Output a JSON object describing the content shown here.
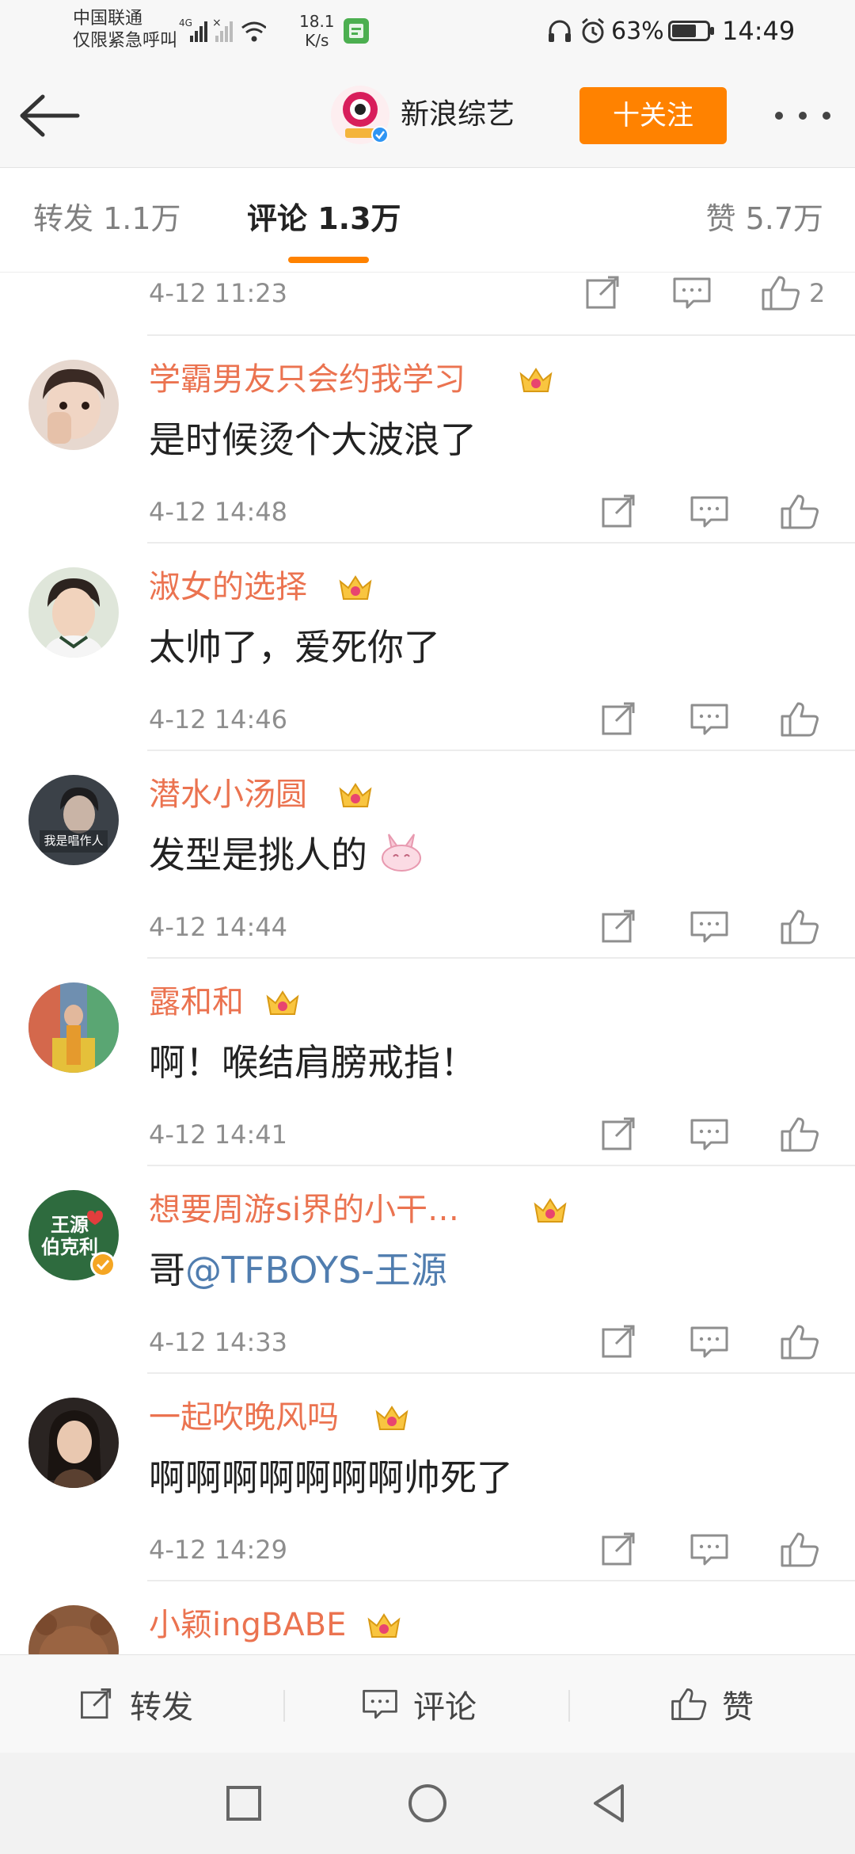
{
  "status_bar": {
    "carrier_line1": "中国联通",
    "carrier_line2": "仅限紧急呼叫",
    "network_type": "4G",
    "speed_value": "18.1",
    "speed_unit": "K/s",
    "battery": "63%",
    "time": "14:49"
  },
  "header": {
    "account_name": "新浪综艺",
    "follow_label": "十关注"
  },
  "tabs": [
    {
      "label": "转发 1.1万"
    },
    {
      "label": "评论 1.3万"
    },
    {
      "label": "赞 5.7万"
    }
  ],
  "partial_comment": {
    "time": "4-12 11:23",
    "like_count": "2"
  },
  "comments": [
    {
      "username": "学霸男友只会约我学习",
      "text": "是时候烫个大波浪了",
      "time": "4-12 14:48"
    },
    {
      "username": "淑女的选择",
      "text": "太帅了，爱死你了",
      "time": "4-12 14:46"
    },
    {
      "username": "潜水小汤圆",
      "text": "发型是挑人的",
      "time": "4-12 14:44",
      "avatar_text": "我是唱作人"
    },
    {
      "username": "露和和",
      "text": "啊！喉结肩膀戒指！",
      "time": "4-12 14:41"
    },
    {
      "username": "想要周游si界的小干…",
      "text_prefix": "哥",
      "mention": "@TFBOYS-王源",
      "time": "4-12 14:33",
      "avatar_text_1": "王源",
      "avatar_text_2": "伯克利"
    },
    {
      "username": "一起吹晚风吗",
      "text": "啊啊啊啊啊啊啊帅死了",
      "time": "4-12 14:29"
    },
    {
      "username": "小颖ingBABE"
    }
  ],
  "bottom_bar": {
    "repost_label": "转发",
    "comment_label": "评论",
    "like_label": "赞"
  },
  "colors": {
    "accent": "#ff8200",
    "username": "#eb7350",
    "mention": "#507daf",
    "muted": "#8e8e8e"
  }
}
